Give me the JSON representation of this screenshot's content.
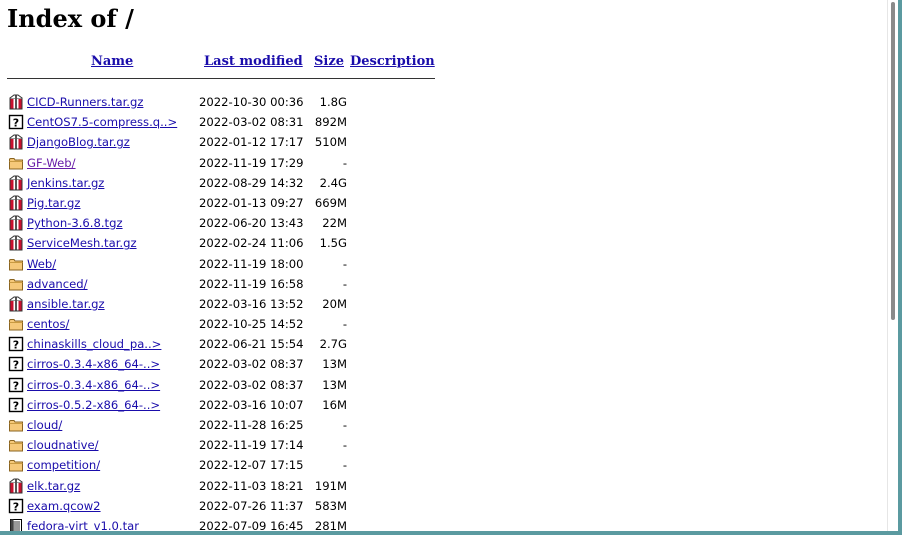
{
  "page": {
    "title": "Index of /"
  },
  "columns": {
    "name": "Name",
    "last_modified": "Last modified",
    "size": "Size",
    "description": "Description"
  },
  "entries": [
    {
      "name": "CICD-Runners.tar.gz",
      "modified": "2022-10-30 00:36",
      "size": "1.8G",
      "icon": "compressed-icon"
    },
    {
      "name": "CentOS7.5-compress.q..>",
      "modified": "2022-03-02 08:31",
      "size": "892M",
      "icon": "unknown-file-icon"
    },
    {
      "name": "DjangoBlog.tar.gz",
      "modified": "2022-01-12 17:17",
      "size": "510M",
      "icon": "compressed-icon"
    },
    {
      "name": "GF-Web/",
      "modified": "2022-11-19 17:29",
      "size": "-",
      "icon": "folder-icon",
      "visited": true
    },
    {
      "name": "Jenkins.tar.gz",
      "modified": "2022-08-29 14:32",
      "size": "2.4G",
      "icon": "compressed-icon"
    },
    {
      "name": "Pig.tar.gz",
      "modified": "2022-01-13 09:27",
      "size": "669M",
      "icon": "compressed-icon"
    },
    {
      "name": "Python-3.6.8.tgz",
      "modified": "2022-06-20 13:43",
      "size": "22M",
      "icon": "compressed-icon"
    },
    {
      "name": "ServiceMesh.tar.gz",
      "modified": "2022-02-24 11:06",
      "size": "1.5G",
      "icon": "compressed-icon"
    },
    {
      "name": "Web/",
      "modified": "2022-11-19 18:00",
      "size": "-",
      "icon": "folder-icon"
    },
    {
      "name": "advanced/",
      "modified": "2022-11-19 16:58",
      "size": "-",
      "icon": "folder-icon"
    },
    {
      "name": "ansible.tar.gz",
      "modified": "2022-03-16 13:52",
      "size": "20M",
      "icon": "compressed-icon"
    },
    {
      "name": "centos/",
      "modified": "2022-10-25 14:52",
      "size": "-",
      "icon": "folder-icon"
    },
    {
      "name": "chinaskills_cloud_pa..>",
      "modified": "2022-06-21 15:54",
      "size": "2.7G",
      "icon": "unknown-file-icon"
    },
    {
      "name": "cirros-0.3.4-x86_64-..>",
      "modified": "2022-03-02 08:37",
      "size": "13M",
      "icon": "unknown-file-icon"
    },
    {
      "name": "cirros-0.3.4-x86_64-..>",
      "modified": "2022-03-02 08:37",
      "size": "13M",
      "icon": "unknown-file-icon"
    },
    {
      "name": "cirros-0.5.2-x86_64-..>",
      "modified": "2022-03-16 10:07",
      "size": "16M",
      "icon": "unknown-file-icon"
    },
    {
      "name": "cloud/",
      "modified": "2022-11-28 16:25",
      "size": "-",
      "icon": "folder-icon"
    },
    {
      "name": "cloudnative/",
      "modified": "2022-11-19 17:14",
      "size": "-",
      "icon": "folder-icon"
    },
    {
      "name": "competition/",
      "modified": "2022-12-07 17:15",
      "size": "-",
      "icon": "folder-icon"
    },
    {
      "name": "elk.tar.gz",
      "modified": "2022-11-03 18:21",
      "size": "191M",
      "icon": "compressed-icon"
    },
    {
      "name": "exam.qcow2",
      "modified": "2022-07-26 11:37",
      "size": "583M",
      "icon": "unknown-file-icon"
    },
    {
      "name": "fedora-virt_v1.0.tar",
      "modified": "2022-07-09 16:45",
      "size": "281M",
      "icon": "tar-file-icon"
    }
  ]
}
